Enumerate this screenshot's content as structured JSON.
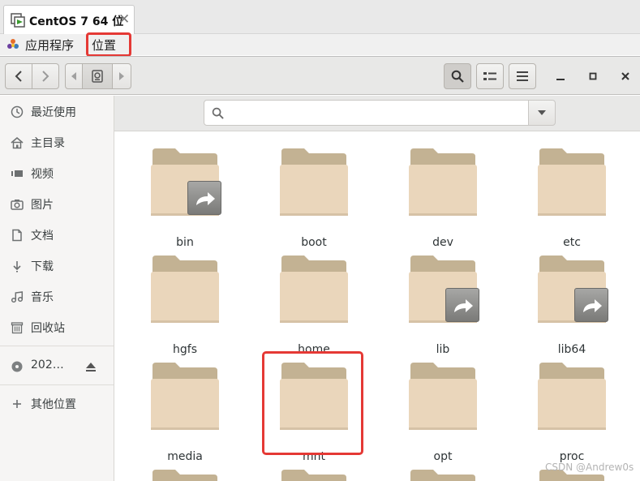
{
  "vm_tab": {
    "title": "CentOS 7 64 位",
    "close_glyph": "✕"
  },
  "topbar": {
    "apps_menu": "应用程序",
    "places_menu": "位置"
  },
  "sidebar": {
    "items": [
      {
        "label": "最近使用",
        "icon": "clock-icon"
      },
      {
        "label": "主目录",
        "icon": "home-icon"
      },
      {
        "label": "视频",
        "icon": "video-icon"
      },
      {
        "label": "图片",
        "icon": "camera-icon"
      },
      {
        "label": "文档",
        "icon": "document-icon"
      },
      {
        "label": "下载",
        "icon": "download-icon"
      },
      {
        "label": "音乐",
        "icon": "music-icon"
      },
      {
        "label": "回收站",
        "icon": "trash-icon"
      }
    ],
    "drive": {
      "label": "202…",
      "icon": "disc-icon"
    },
    "other_places": {
      "label": "其他位置",
      "icon": "plus-icon"
    }
  },
  "files": [
    {
      "name": "bin",
      "symlink": true
    },
    {
      "name": "boot",
      "symlink": false
    },
    {
      "name": "dev",
      "symlink": false
    },
    {
      "name": "etc",
      "symlink": false
    },
    {
      "name": "hgfs",
      "symlink": false
    },
    {
      "name": "home",
      "symlink": false
    },
    {
      "name": "lib",
      "symlink": true
    },
    {
      "name": "lib64",
      "symlink": true
    },
    {
      "name": "media",
      "symlink": false
    },
    {
      "name": "mnt",
      "symlink": false
    },
    {
      "name": "opt",
      "symlink": false
    },
    {
      "name": "proc",
      "symlink": false
    }
  ],
  "watermark": "CSDN @Andrew0s",
  "colors": {
    "folder_back": "#c3b293",
    "folder_front": "#ead6bb",
    "highlight": "#e53935"
  }
}
